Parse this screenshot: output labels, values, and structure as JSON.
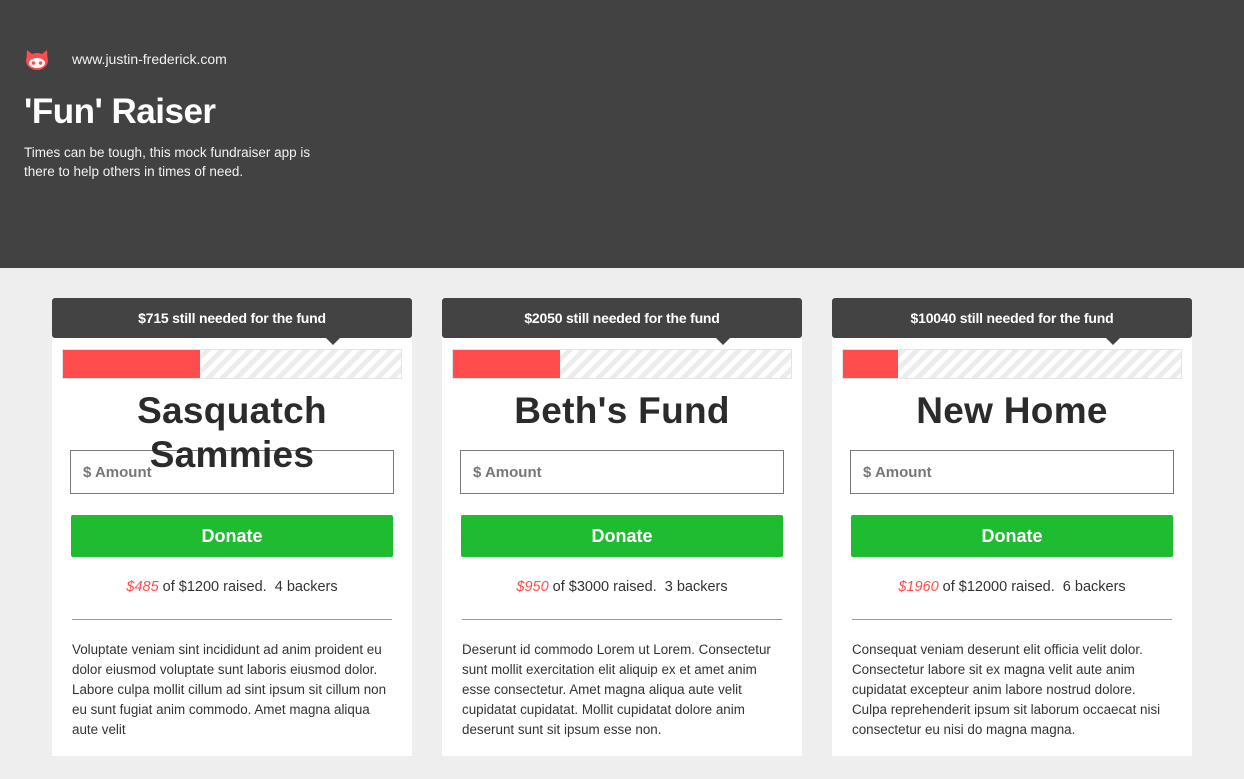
{
  "header": {
    "logo_icon": "octocat-icon",
    "url": "www.justin-frederick.com",
    "title": "'Fun' Raiser",
    "tagline": "Times can be tough, this mock fundraiser app is there to help others in times of need."
  },
  "colors": {
    "header_bg": "#424242",
    "accent_red": "#ff4c4c",
    "donate_green": "#1fbb30",
    "page_bg": "#eeeeee"
  },
  "funds": [
    {
      "tooltip": "$715 still needed for the fund",
      "progress_percent": 40.4,
      "name": "Sasquatch Sammies",
      "amount_placeholder": "$ Amount",
      "donate_label": "Donate",
      "raised": "$485",
      "goal_text": "of $1200 raised.",
      "backers": "4 backers",
      "description": "Voluptate veniam sint incididunt ad anim proident eu dolor eiusmod voluptate sunt laboris eiusmod dolor. Labore culpa mollit cillum ad sint ipsum sit cillum non eu sunt fugiat anim commodo. Amet magna aliqua aute velit"
    },
    {
      "tooltip": "$2050 still needed for the fund",
      "progress_percent": 31.7,
      "name": "Beth's Fund",
      "amount_placeholder": "$ Amount",
      "donate_label": "Donate",
      "raised": "$950",
      "goal_text": "of $3000 raised.",
      "backers": "3 backers",
      "description": "Deserunt id commodo Lorem ut Lorem. Consectetur sunt mollit exercitation elit aliquip ex et amet anim esse consectetur. Amet magna aliqua aute velit cupidatat cupidatat. Mollit cupidatat dolore anim deserunt sunt sit ipsum esse non."
    },
    {
      "tooltip": "$10040 still needed for the fund",
      "progress_percent": 16.3,
      "name": "New Home",
      "amount_placeholder": "$ Amount",
      "donate_label": "Donate",
      "raised": "$1960",
      "goal_text": "of $12000 raised.",
      "backers": "6 backers",
      "description": "Consequat veniam deserunt elit officia velit dolor. Consectetur labore sit ex magna velit aute anim cupidatat excepteur anim labore nostrud dolore. Culpa reprehenderit ipsum sit laborum occaecat nisi consectetur eu nisi do magna magna."
    }
  ]
}
